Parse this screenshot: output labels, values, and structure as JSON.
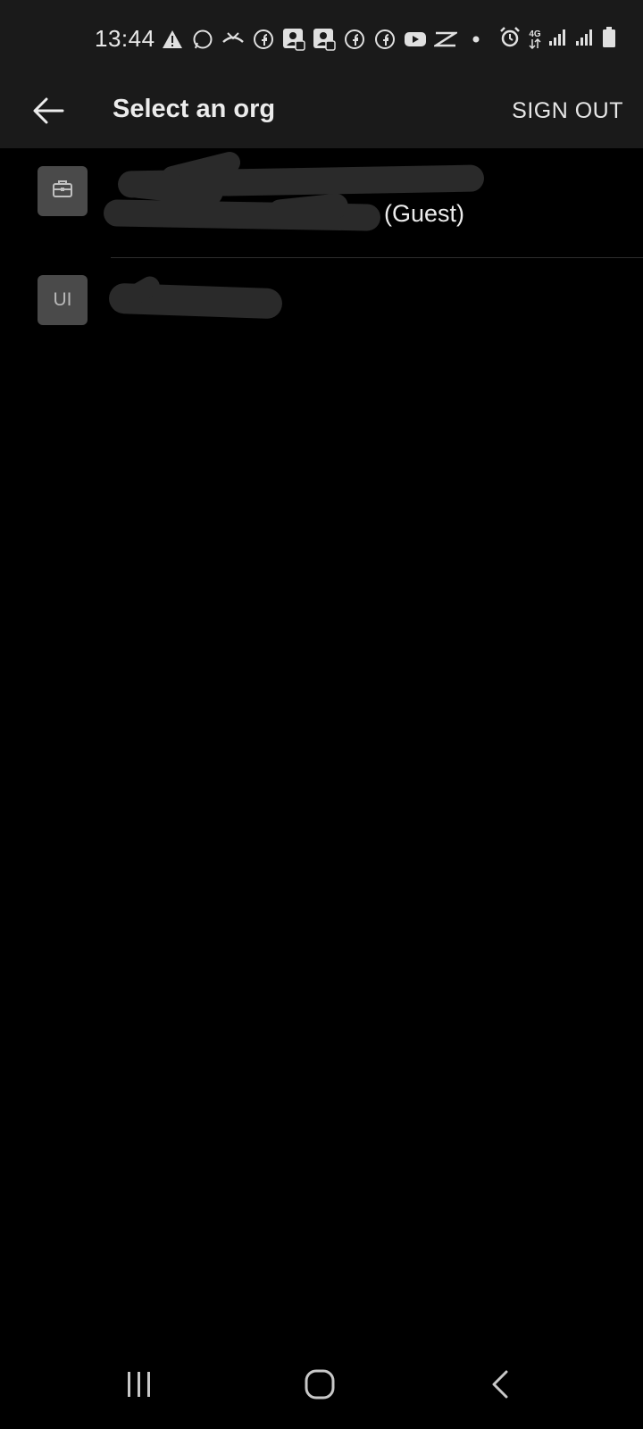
{
  "status_bar": {
    "time": "13:44",
    "notification_icons": [
      "warning-icon",
      "whatsapp-icon",
      "missed-call-icon",
      "facebook-icon",
      "facebook-contact-icon",
      "facebook-contact-icon",
      "facebook-icon",
      "facebook-icon",
      "youtube-icon",
      "capcut-icon",
      "dot-icon"
    ],
    "right_icons": [
      "alarm-icon",
      "network-4g-icon",
      "signal-icon",
      "signal-icon",
      "battery-icon"
    ],
    "network_label": "4G"
  },
  "app_bar": {
    "title": "Select an org",
    "sign_out_label": "SIGN OUT"
  },
  "orgs": [
    {
      "avatar_icon": "briefcase-icon",
      "name_line2_visible": "(Guest)",
      "redacted": true
    },
    {
      "avatar_initials": "UI",
      "redacted": true
    }
  ],
  "colors": {
    "appbar_bg": "#1a1a1a",
    "page_bg": "#000000",
    "avatar_bg": "#4a4a4a",
    "text_primary": "#ececec",
    "redaction": "#2a2a2a"
  }
}
